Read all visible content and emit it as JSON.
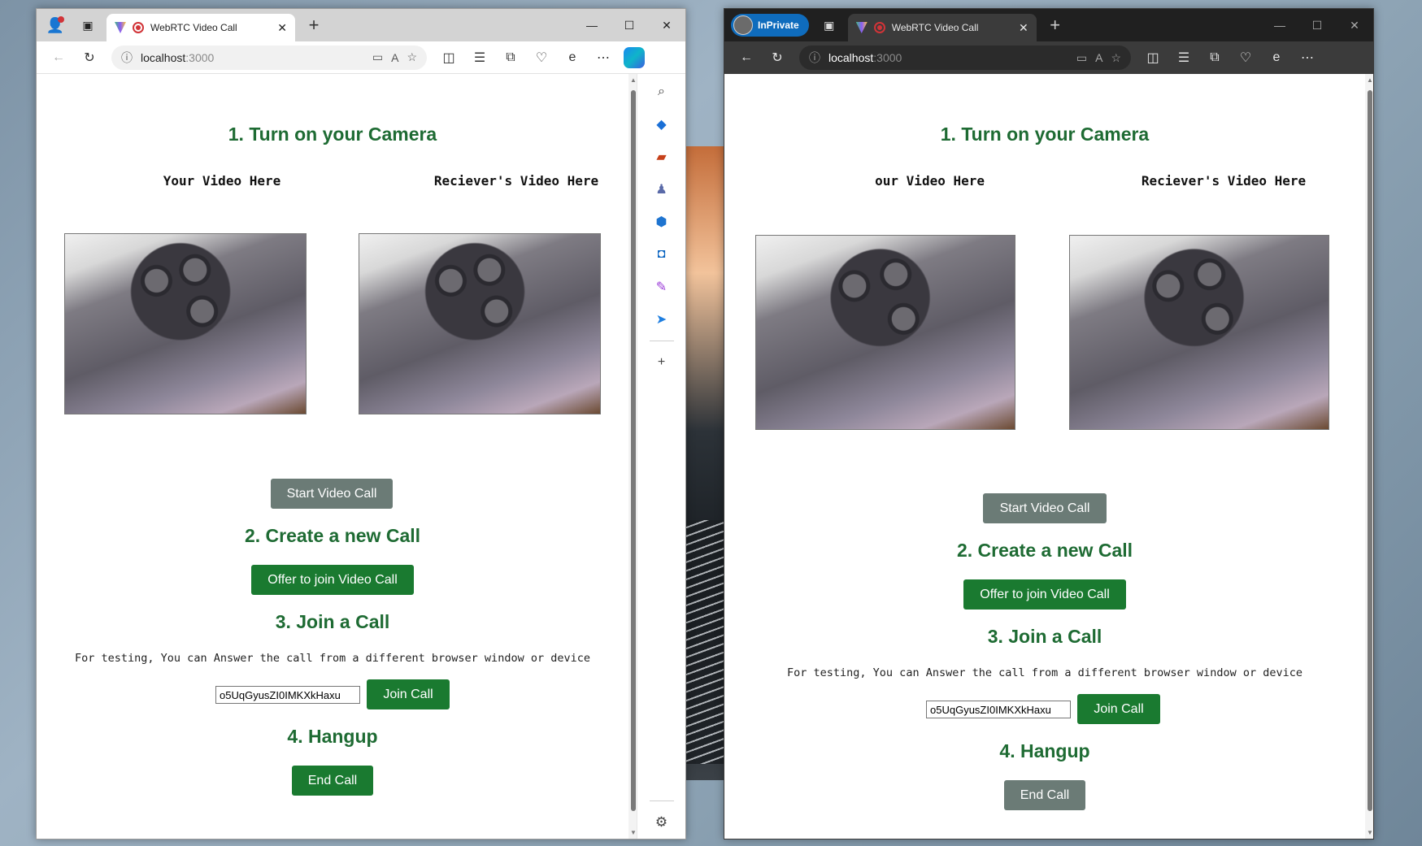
{
  "left_window": {
    "tab": {
      "title": "WebRTC Video Call",
      "close_glyph": "✕"
    },
    "new_tab_glyph": "+",
    "window_controls": {
      "minimize": "—",
      "maximize": "☐",
      "close": "✕"
    },
    "address": {
      "host": "localhost",
      "port": ":3000"
    },
    "sidebar_icons": [
      "search-icon",
      "tag-icon",
      "toolbox-icon",
      "games-icon",
      "microsoft365-icon",
      "outlook-icon",
      "designer-icon",
      "send-icon",
      "add-icon",
      "settings-icon"
    ]
  },
  "right_window": {
    "inprivate_label": "InPrivate",
    "tab": {
      "title": "WebRTC Video Call",
      "close_glyph": "✕"
    },
    "new_tab_glyph": "+",
    "window_controls": {
      "minimize": "—",
      "maximize": "☐",
      "close": "✕"
    },
    "address": {
      "host": "localhost",
      "port": ":3000"
    }
  },
  "page": {
    "step1_heading": "1. Turn on your Camera",
    "your_video_label": "Your Video Here",
    "your_video_label_cropped": "our Video Here",
    "receiver_video_label": "Reciever's Video Here",
    "start_button": "Start Video Call",
    "step2_heading": "2. Create a new Call",
    "offer_button": "Offer to join Video Call",
    "step3_heading": "3. Join a Call",
    "testing_note": "For testing, You can Answer the call from a different browser window or device",
    "call_id": "o5UqGyusZI0IMKXkHaxu",
    "join_button": "Join Call",
    "step4_heading": "4. Hangup",
    "end_button": "End Call"
  },
  "colors": {
    "heading_green": "#1e6b33",
    "button_green": "#1a7a30",
    "button_gray": "#6b7b76",
    "inprivate_blue": "#0f6cbd"
  }
}
